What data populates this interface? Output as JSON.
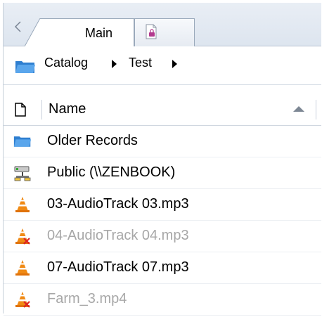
{
  "tabs": [
    {
      "label": "Main",
      "active": true
    },
    {
      "label": "",
      "icon": "document-lock-icon",
      "active": false
    }
  ],
  "breadcrumb": {
    "icon": "folder-icon",
    "items": [
      "Catalog",
      "Test"
    ]
  },
  "columns": {
    "name_header": "Name",
    "sort": "ascending"
  },
  "files": [
    {
      "name": "Older Records",
      "icon": "folder-icon",
      "dimmed": false
    },
    {
      "name": "Public (\\\\ZENBOOK)",
      "icon": "network-drive-icon",
      "dimmed": false
    },
    {
      "name": "03-AudioTrack 03.mp3",
      "icon": "vlc-cone-icon",
      "dimmed": false
    },
    {
      "name": "04-AudioTrack 04.mp3",
      "icon": "vlc-cone-offline-icon",
      "dimmed": true
    },
    {
      "name": "07-AudioTrack 07.mp3",
      "icon": "vlc-cone-icon",
      "dimmed": false
    },
    {
      "name": "Farm_3.mp4",
      "icon": "vlc-cone-offline-icon",
      "dimmed": true
    }
  ],
  "colors": {
    "tab_border": "#9aa9bb",
    "folder_blue": "#3d8ad8",
    "vlc_orange": "#f08a14",
    "dim_text": "#a7a7a7"
  }
}
